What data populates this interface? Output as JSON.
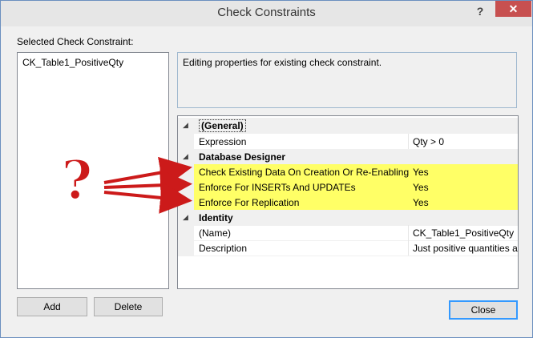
{
  "window": {
    "title": "Check Constraints",
    "help_label": "?",
    "close_label": "✕"
  },
  "left_panel": {
    "label": "Selected Check Constraint:",
    "items": [
      "CK_Table1_PositiveQty"
    ]
  },
  "description_text": "Editing properties for existing check constraint.",
  "properties": [
    {
      "type": "category",
      "name": "(General)"
    },
    {
      "type": "property",
      "name": "Expression",
      "value": "Qty > 0"
    },
    {
      "type": "category",
      "name": "Database Designer"
    },
    {
      "type": "property",
      "name": "Check Existing Data On Creation Or Re-Enabling",
      "value": "Yes",
      "highlight": true
    },
    {
      "type": "property",
      "name": "Enforce For INSERTs And UPDATEs",
      "value": "Yes",
      "highlight": true
    },
    {
      "type": "property",
      "name": "Enforce For Replication",
      "value": "Yes",
      "highlight": true
    },
    {
      "type": "category",
      "name": "Identity"
    },
    {
      "type": "property",
      "name": "(Name)",
      "value": "CK_Table1_PositiveQty"
    },
    {
      "type": "property",
      "name": "Description",
      "value": "Just positive quantities ar"
    }
  ],
  "buttons": {
    "add": "Add",
    "delete": "Delete",
    "close": "Close"
  },
  "annotation": {
    "symbol": "?",
    "color": "#cc1a1a",
    "highlight_color": "#ffff66"
  },
  "icons": {
    "expander": "collapse-triangle-icon"
  }
}
